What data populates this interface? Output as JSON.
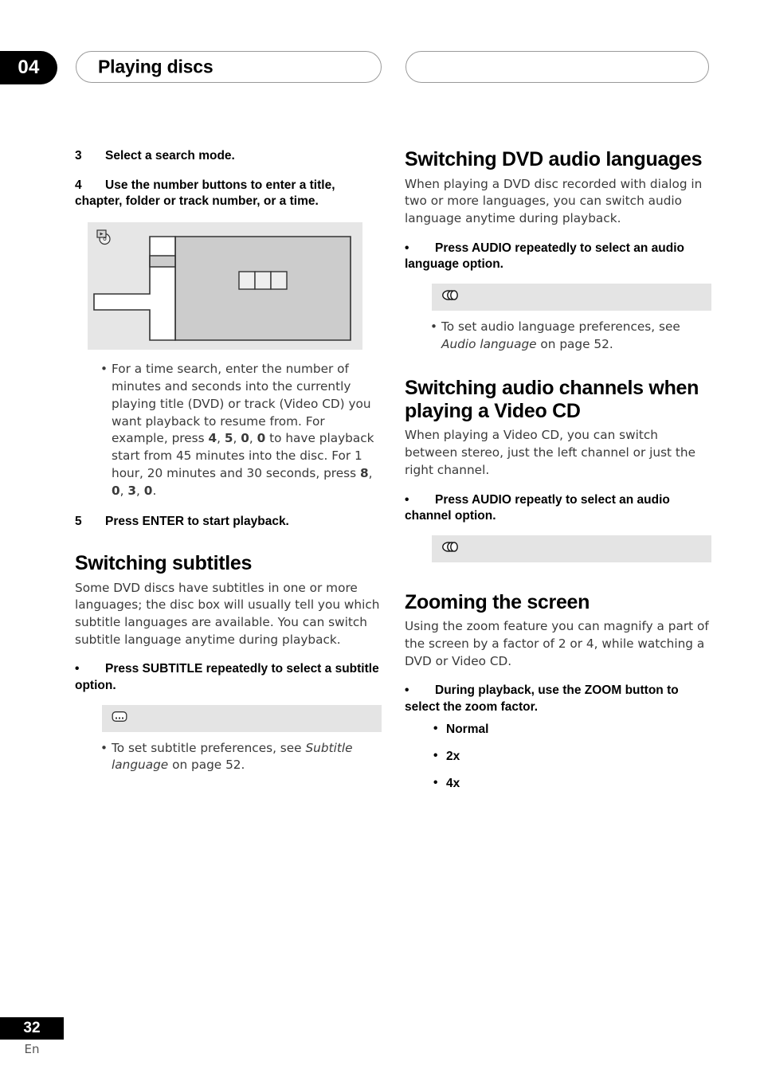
{
  "header": {
    "chapter_number": "04",
    "chapter_title": "Playing discs",
    "right_pill_text": ""
  },
  "footer": {
    "page_number": "32",
    "language_code": "En"
  },
  "left_column": {
    "step3": {
      "num": "3",
      "text": "Select a search mode."
    },
    "step4": {
      "num": "4",
      "text": "Use the number buttons to enter a title, chapter, folder or track number, or a time."
    },
    "figure": {
      "icon_name": "dvd-video-disc-icon",
      "caption": ""
    },
    "time_search_note": "For a time search, enter the number of minutes and seconds into the currently playing title (DVD) or track (Video CD) you want playback to resume from. For example, press 4, 5, 0, 0 to have playback start from 45 minutes into the disc. For 1 hour, 20 minutes and 30 seconds, press 8, 0, 3, 0.",
    "step5": {
      "num": "5",
      "text": "Press ENTER to start playback."
    },
    "subtitles_section": {
      "heading": "Switching subtitles",
      "body": "Some DVD discs have subtitles in one or more languages; the disc box will usually tell you which subtitle languages are available. You can switch subtitle language anytime during playback.",
      "instruction": "Press SUBTITLE repeatedly to select a subtitle option.",
      "icon_name": "subtitle-icon",
      "note": "To set subtitle preferences, see Subtitle language on page 52.",
      "note_plain_1": "To set subtitle preferences, see ",
      "note_italic": "Subtitle language",
      "note_plain_2": " on page 52."
    }
  },
  "right_column": {
    "dvd_audio_section": {
      "heading": "Switching DVD audio languages",
      "body": "When playing a DVD disc recorded with dialog in two or more languages, you can switch audio language anytime during playback.",
      "instruction": "Press AUDIO repeatedly to select an audio language option.",
      "icon_name": "audio-channels-icon",
      "note_plain_1": "To set audio language preferences, see ",
      "note_italic": "Audio language",
      "note_plain_2": " on page 52."
    },
    "audio_channels_section": {
      "heading": "Switching audio channels when playing a Video CD",
      "body": "When playing a Video CD, you can switch between stereo, just the left channel or just the right channel.",
      "instruction": "Press AUDIO repeatly to select an audio channel option.",
      "icon_name": "audio-channels-icon"
    },
    "zoom_section": {
      "heading": "Zooming the screen",
      "body": "Using the zoom feature you can magnify a part of the screen by a factor of 2 or 4, while watching a DVD or Video CD.",
      "instruction": "During playback, use the ZOOM button to select the zoom factor.",
      "options": [
        "Normal",
        "2x",
        "4x"
      ]
    }
  },
  "colors": {
    "strip_gray": "#e4e4e4",
    "figure_gray": "#e6e6e6",
    "figure_fill_gray": "#cccccc",
    "black": "#000000",
    "body_text": "#3a3a3a"
  }
}
